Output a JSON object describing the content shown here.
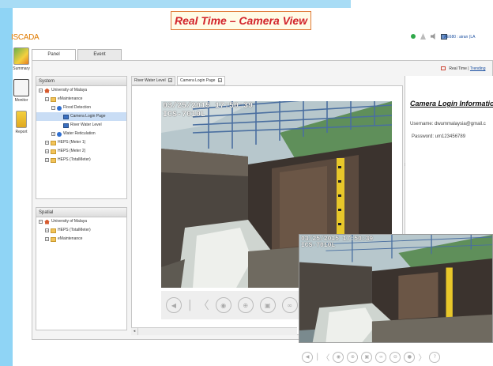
{
  "caption": "Real Time – Camera View",
  "app": {
    "brand": "ISCADA",
    "user_info": "AE680 : airan (LA"
  },
  "leftnav": {
    "items": [
      {
        "label": "Summary",
        "icon": "summary-icon"
      },
      {
        "label": "Monitor",
        "icon": "monitor-icon"
      },
      {
        "label": "Report",
        "icon": "report-icon"
      }
    ]
  },
  "panel_tabs": [
    "Panel",
    "Event"
  ],
  "realtime": {
    "realtime_label": "Real Time",
    "separator": "|",
    "trending_label": "Trending"
  },
  "system_tree": {
    "title": "System",
    "nodes": [
      {
        "label": "University of Malaya",
        "toggle": "−",
        "icon": "home"
      },
      {
        "label": "eMaintenance",
        "toggle": "−",
        "icon": "folder"
      },
      {
        "label": "Flood Detection",
        "toggle": "−",
        "icon": "globe"
      },
      {
        "label": "Camera Login Page",
        "toggle": "",
        "icon": "cam"
      },
      {
        "label": "River Water Level",
        "toggle": "",
        "icon": "cam"
      },
      {
        "label": "Water Reticulation",
        "toggle": "+",
        "icon": "globe"
      },
      {
        "label": "HEPS (Meter 1)",
        "toggle": "+",
        "icon": "folder"
      },
      {
        "label": "HEPS (Meter 2)",
        "toggle": "+",
        "icon": "folder"
      },
      {
        "label": "HEPS (TotalMeter)",
        "toggle": "+",
        "icon": "folder"
      }
    ]
  },
  "spatial_tree": {
    "title": "Spatial",
    "nodes": [
      {
        "label": "University of Malaya",
        "toggle": "−",
        "icon": "home"
      },
      {
        "label": "HEPS (TotalMeter)",
        "toggle": "+",
        "icon": "folder"
      },
      {
        "label": "eMaintenance",
        "toggle": "+",
        "icon": "folder"
      }
    ]
  },
  "content_tabs": [
    "River Water Level",
    "Camera Login Page"
  ],
  "camera_info": {
    "title": "Camera Login Information:",
    "username": "Username: dwummalaysia@gmail.c",
    "password": "Password: um123456789"
  },
  "camera": {
    "timestamp": "03/25/2015 17:50:39",
    "camera_id": "ICS-7010L"
  },
  "icons": {
    "main_controls": [
      "speaker-icon",
      "separator",
      "prev-icon",
      "snapshot-icon",
      "zoom-icon",
      "record-icon",
      "stream-icon"
    ],
    "inset_controls": [
      "speaker-icon",
      "separator",
      "prev-icon",
      "snapshot-icon",
      "zoom-icon",
      "record-icon",
      "stream-icon",
      "link-icon",
      "mic-icon",
      "next-icon",
      "extra-icon"
    ]
  },
  "colors": {
    "caption_red": "#d2232a",
    "caption_border": "#e07b39",
    "brand_orange": "#e07b00",
    "left_strip": "#8fd4f5",
    "selected_row": "#c9ddf5"
  }
}
